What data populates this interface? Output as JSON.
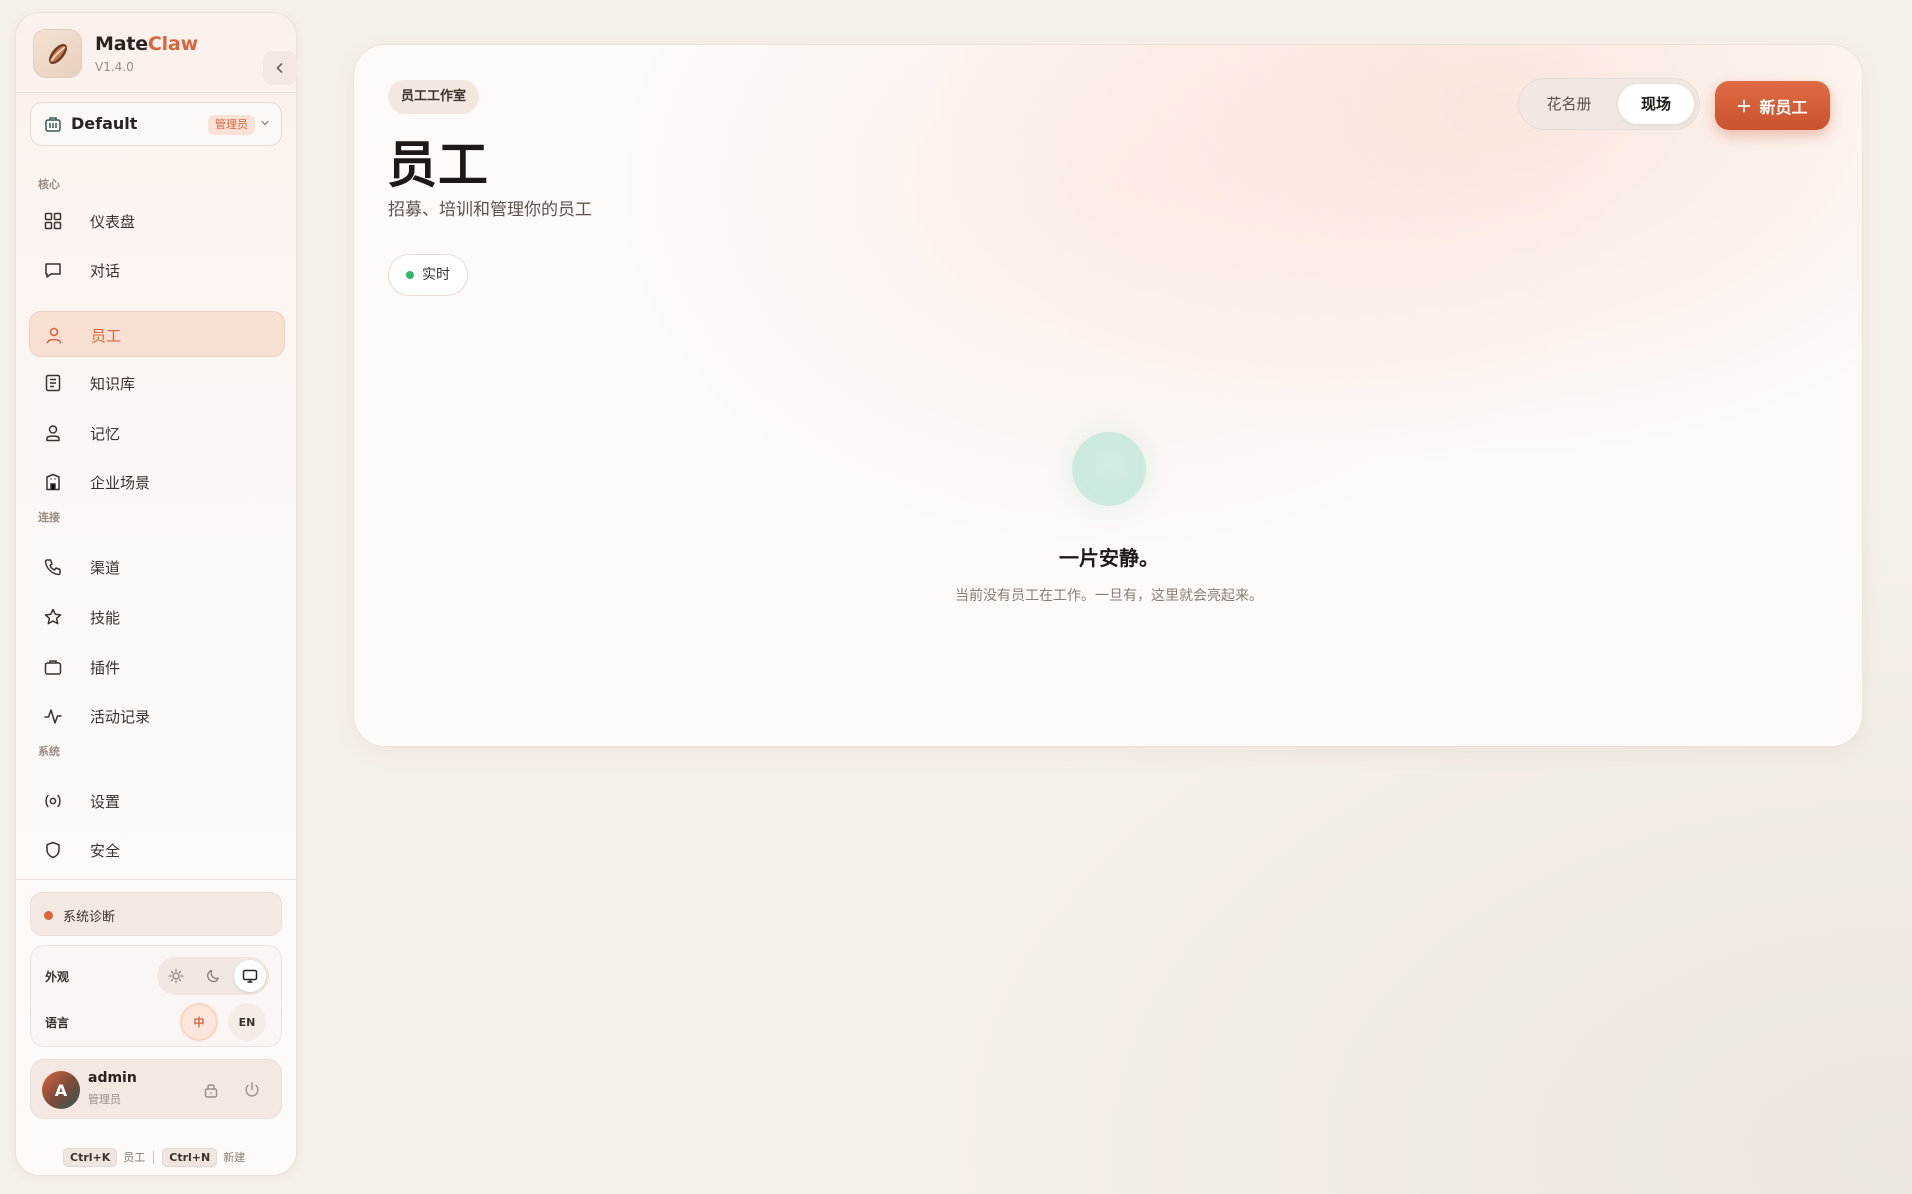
{
  "brand": {
    "name_main": "Mate",
    "name_accent": "Claw",
    "version": "V1.4.0"
  },
  "workspace": {
    "name": "Default",
    "badge": "管理员"
  },
  "sidebar": {
    "sections": [
      {
        "title": "核心",
        "items": [
          {
            "label": "仪表盘",
            "icon": "dashboard-icon"
          },
          {
            "label": "对话",
            "icon": "chat-icon"
          },
          {
            "label": "员工",
            "icon": "user-icon",
            "active": true
          },
          {
            "label": "知识库",
            "icon": "book-icon"
          },
          {
            "label": "记忆",
            "icon": "memory-icon"
          },
          {
            "label": "企业场景",
            "icon": "building-icon"
          }
        ]
      },
      {
        "title": "连接",
        "items": [
          {
            "label": "渠道",
            "icon": "phone-icon"
          },
          {
            "label": "技能",
            "icon": "star-icon"
          },
          {
            "label": "插件",
            "icon": "briefcase-icon"
          },
          {
            "label": "活动记录",
            "icon": "activity-icon"
          }
        ]
      },
      {
        "title": "系统",
        "items": [
          {
            "label": "设置",
            "icon": "settings-icon"
          },
          {
            "label": "安全",
            "icon": "shield-icon"
          }
        ]
      }
    ],
    "diagnostics": "系统诊断",
    "prefs": {
      "appearance_label": "外观",
      "language_label": "语言",
      "theme_options": [
        "light",
        "dark",
        "system"
      ],
      "theme_active": "system",
      "lang_zh": "中",
      "lang_en": "EN",
      "lang_active": "zh"
    },
    "user": {
      "avatar_letter": "A",
      "name": "admin",
      "role": "管理员"
    },
    "shortcuts": [
      {
        "key": "Ctrl+K",
        "label": "员工"
      },
      {
        "key": "Ctrl+N",
        "label": "新建"
      }
    ]
  },
  "main": {
    "badge": "员工工作室",
    "title": "员工",
    "subtitle": "招募、培训和管理你的员工",
    "live_label": "实时",
    "view_toggle": {
      "roster": "花名册",
      "live": "现场",
      "active": "live"
    },
    "new_button": "新员工",
    "empty": {
      "title": "一片安静。",
      "description": "当前没有员工在工作。一旦有，这里就会亮起来。"
    }
  },
  "colors": {
    "accent": "#d8653f",
    "live_dot": "#35b36a",
    "empty_orb": "#cbe9dc"
  }
}
